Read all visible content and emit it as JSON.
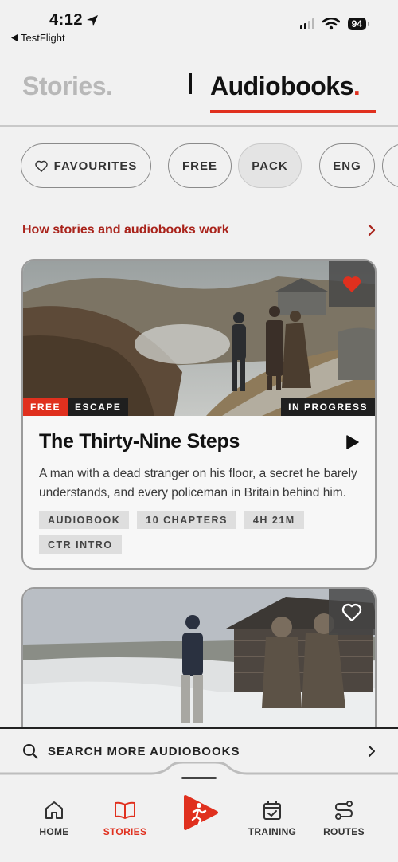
{
  "status_bar": {
    "time": "4:12",
    "back_app": "TestFlight",
    "battery": "94"
  },
  "top_tabs": {
    "stories": "Stories.",
    "audiobooks_text": "Audiobooks",
    "audiobooks_dot": "."
  },
  "filters": [
    {
      "label": "FAVOURITES",
      "icon": "heart-outline-icon"
    },
    {
      "label": "FREE"
    },
    {
      "label": "PACK",
      "selected": true
    },
    {
      "label": "ENG"
    }
  ],
  "how_link": "How stories and audiobooks work",
  "cards": [
    {
      "title": "The Thirty-Nine Steps",
      "description": "A man with a dead stranger on his floor, a secret he barely understands, and every policeman in Britain behind him.",
      "badges": [
        "FREE",
        "ESCAPE"
      ],
      "status": "IN PROGRESS",
      "favourite": true,
      "tags": [
        "AUDIOBOOK",
        "10 CHAPTERS",
        "4H 21M",
        "CTR INTRO"
      ]
    },
    {
      "favourite": false
    }
  ],
  "search": {
    "label": "SEARCH MORE AUDIOBOOKS"
  },
  "bottom_nav": [
    {
      "label": "HOME",
      "icon": "home-icon"
    },
    {
      "label": "STORIES",
      "icon": "book-icon",
      "active": true
    },
    {
      "label": "",
      "icon": "runner-logo-icon"
    },
    {
      "label": "TRAINING",
      "icon": "calendar-check-icon"
    },
    {
      "label": "ROUTES",
      "icon": "route-icon"
    }
  ],
  "colors": {
    "accent": "#e0301e",
    "link": "#a9231b",
    "background": "#f1f1f1"
  }
}
